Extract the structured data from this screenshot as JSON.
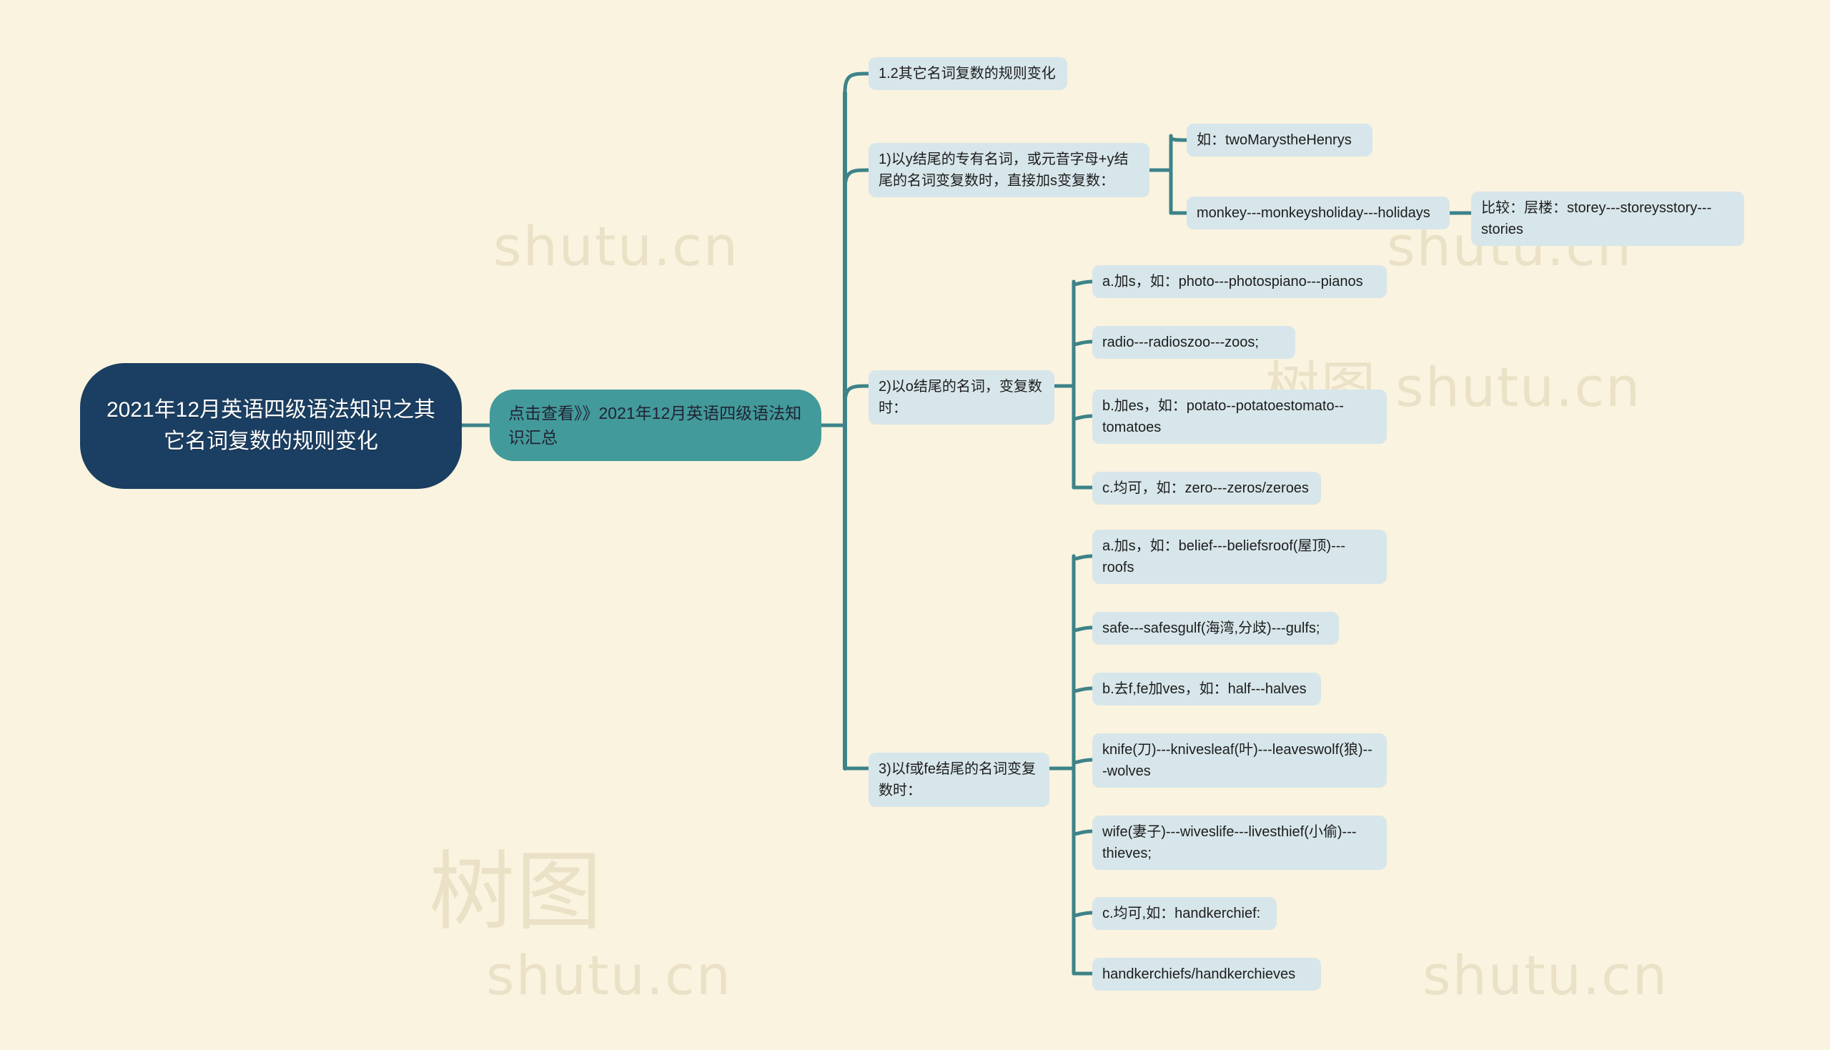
{
  "canvas": {
    "background": "#faf3df",
    "link_color": "#3d8389",
    "root_color": "#1b3f62",
    "level2_color": "#439a9b",
    "leaf_color": "#d7e6ea"
  },
  "watermarks": [
    {
      "text": "shutu.cn"
    },
    {
      "text": "shutu.cn"
    },
    {
      "text": "shutu.cn"
    },
    {
      "text": "shutu.cn"
    },
    {
      "text": "树图 shutu.cn"
    },
    {
      "text": "树图"
    }
  ],
  "mindmap": {
    "root": {
      "label": "2021年12月英语四级语法知识之其它名词复数的规则变化"
    },
    "level2": {
      "label": "点击查看》》2021年12月英语四级语法知识汇总"
    },
    "branches": [
      {
        "id": "b1",
        "label": "1.2其它名词复数的规则变化",
        "children": []
      },
      {
        "id": "b2",
        "label": "1)以y结尾的专有名词，或元音字母+y结尾的名词变复数时，直接加s变复数：",
        "children": [
          {
            "id": "b2c1",
            "label": "如：twoMarystheHenrys",
            "children": []
          },
          {
            "id": "b2c2",
            "label": "monkey---monkeysholiday---holidays",
            "children": [
              {
                "id": "b2c2c1",
                "label": "比较：层楼：storey---storeysstory---stories",
                "children": []
              }
            ]
          }
        ]
      },
      {
        "id": "b3",
        "label": "2)以o结尾的名词，变复数时：",
        "children": [
          {
            "id": "b3c1",
            "label": "a.加s，如：photo---photospiano---pianos",
            "children": []
          },
          {
            "id": "b3c2",
            "label": "radio---radioszoo---zoos;",
            "children": []
          },
          {
            "id": "b3c3",
            "label": "b.加es，如：potato--potatoestomato--tomatoes",
            "children": []
          },
          {
            "id": "b3c4",
            "label": "c.均可，如：zero---zeros/zeroes",
            "children": []
          }
        ]
      },
      {
        "id": "b4",
        "label": "3)以f或fe结尾的名词变复数时：",
        "children": [
          {
            "id": "b4c1",
            "label": "a.加s，如：belief---beliefsroof(屋顶)---roofs",
            "children": []
          },
          {
            "id": "b4c2",
            "label": "safe---safesgulf(海湾,分歧)---gulfs;",
            "children": []
          },
          {
            "id": "b4c3",
            "label": "b.去f,fe加ves，如：half---halves",
            "children": []
          },
          {
            "id": "b4c4",
            "label": "knife(刀)---knivesleaf(叶)---leaveswolf(狼)---wolves",
            "children": []
          },
          {
            "id": "b4c5",
            "label": "wife(妻子)---wiveslife---livesthief(小偷)---thieves;",
            "children": []
          },
          {
            "id": "b4c6",
            "label": "c.均可,如：handkerchief:",
            "children": []
          },
          {
            "id": "b4c7",
            "label": "handkerchiefs/handkerchieves",
            "children": []
          }
        ]
      }
    ]
  }
}
